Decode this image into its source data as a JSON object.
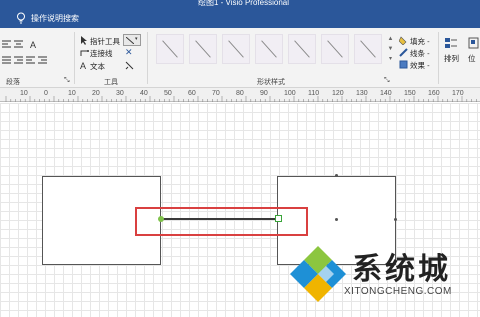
{
  "window": {
    "title": "绘图1 - Visio Professional"
  },
  "tell_me": {
    "text": "操作说明搜索"
  },
  "ribbon": {
    "paragraph_group_label": "段落",
    "tools_group_label": "工具",
    "tools": {
      "pointer": "指针工具",
      "connector": "连接线",
      "text": "文本"
    },
    "shape_styles_label": "形状样式",
    "fill_label": "填充",
    "line_label": "线条",
    "effects_label": "效果",
    "arrange_label": "排列",
    "position_label": "位"
  },
  "ruler": {
    "labels": [
      "10",
      "0",
      "10",
      "20",
      "30",
      "40",
      "50",
      "60",
      "70",
      "80",
      "90",
      "100",
      "110",
      "120",
      "130",
      "140",
      "150",
      "160",
      "170"
    ]
  },
  "watermark": {
    "brand": "系统城",
    "url": "XITONGCHENG.COM"
  },
  "colors": {
    "title_bar": "#2b579a",
    "ribbon_bg": "#f3f3f3",
    "highlight_box": "#d94040",
    "connector_start": "#7fc24a",
    "connector_end": "#3aa53a"
  }
}
